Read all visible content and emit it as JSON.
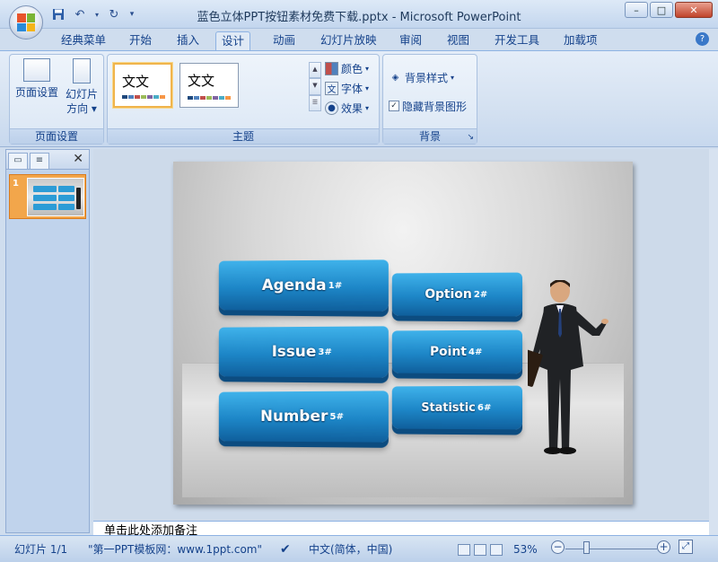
{
  "window": {
    "title": "蓝色立体PPT按钮素材免费下载.pptx - Microsoft PowerPoint",
    "min": "–",
    "max": "□",
    "close": "✕"
  },
  "tabs": [
    "经典菜单",
    "开始",
    "插入",
    "设计",
    "动画",
    "幻灯片放映",
    "审阅",
    "视图",
    "开发工具",
    "加载项"
  ],
  "active_tab": "设计",
  "ribbon": {
    "page_setup": {
      "page_setup_label": "页面设置",
      "orientation_label_1": "幻灯片",
      "orientation_label_2": "方向",
      "group_title": "页面设置"
    },
    "themes": {
      "theme1_text": "文文",
      "theme2_text": "文文",
      "colors_label": "颜色",
      "fonts_label": "字体",
      "effects_label": "效果",
      "group_title": "主题"
    },
    "background": {
      "bg_styles_label": "背景样式",
      "hide_bg_label": "隐藏背景图形",
      "hide_bg_checked": "✓",
      "group_title": "背景"
    }
  },
  "left_pane": {
    "close": "✕",
    "slide_number": "1"
  },
  "slide": {
    "buttons": [
      {
        "label": "Agenda",
        "num": "1#"
      },
      {
        "label": "Option",
        "num": "2#"
      },
      {
        "label": "Issue",
        "num": "3#"
      },
      {
        "label": "Point",
        "num": "4#"
      },
      {
        "label": "Number",
        "num": "5#"
      },
      {
        "label": "Statistic",
        "num": "6#"
      }
    ]
  },
  "notes": {
    "placeholder": "单击此处添加备注"
  },
  "status": {
    "slide_info": "幻灯片 1/1",
    "template": "\"第一PPT模板网：www.1ppt.com\"",
    "language": "中文(简体，中国)",
    "zoom": "53%",
    "zoom_out": "−",
    "zoom_in": "+"
  },
  "colors": {
    "accent_blue": "#1d86c7",
    "selection_orange": "#f2a64b"
  }
}
